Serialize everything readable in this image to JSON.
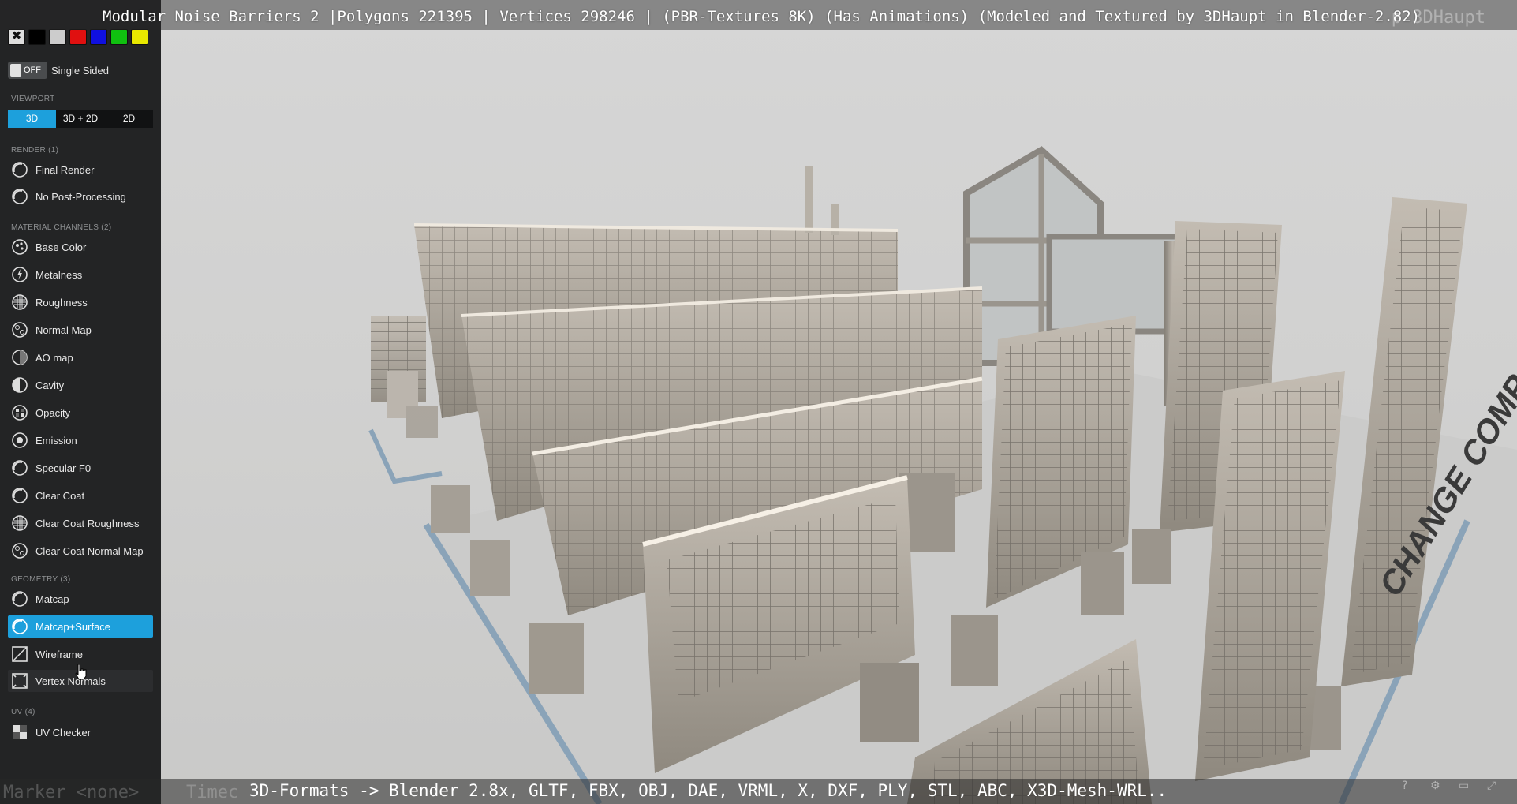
{
  "title": "Modular Noise Barriers 2 |Polygons 221395 | Vertices 298246 | (PBR-Textures 8K) (Has Animations) (Modeled and Textured by 3DHaupt in Blender-2.82)",
  "ghost_title_right": "p 3DHaupt",
  "bottom_caption": "3D-Formats -> Blender 2.8x, GLTF, FBX, OBJ, DAE, VRML, X, DXF, PLY, STL, ABC, X3D-Mesh-WRL..",
  "ghost_bottom_left": "Marker <none>",
  "ghost_bottom_mid": "Timec",
  "scene_banner": "CHANGE COMPONENTS",
  "sidebar": {
    "swatches": {
      "none_glyph": "✖",
      "colors": [
        "#000000",
        "#cccccc",
        "#e01010",
        "#1010e0",
        "#10c010",
        "#e8e800"
      ]
    },
    "single_sided": {
      "state": "OFF",
      "label": "Single Sided"
    },
    "viewport": {
      "label": "VIEWPORT",
      "options": [
        "3D",
        "3D + 2D",
        "2D"
      ],
      "selected": "3D"
    },
    "render": {
      "label": "RENDER (1)",
      "items": [
        "Final Render",
        "No Post-Processing"
      ]
    },
    "material_channels": {
      "label": "MATERIAL CHANNELS (2)",
      "items": [
        "Base Color",
        "Metalness",
        "Roughness",
        "Normal Map",
        "AO map",
        "Cavity",
        "Opacity",
        "Emission",
        "Specular F0",
        "Clear Coat",
        "Clear Coat Roughness",
        "Clear Coat Normal Map"
      ]
    },
    "geometry": {
      "label": "GEOMETRY (3)",
      "items": [
        "Matcap",
        "Matcap+Surface",
        "Wireframe",
        "Vertex Normals"
      ],
      "selected": "Matcap+Surface"
    },
    "uv": {
      "label": "UV (4)",
      "items": [
        "UV Checker"
      ]
    }
  },
  "accent_color": "#1da0dc"
}
